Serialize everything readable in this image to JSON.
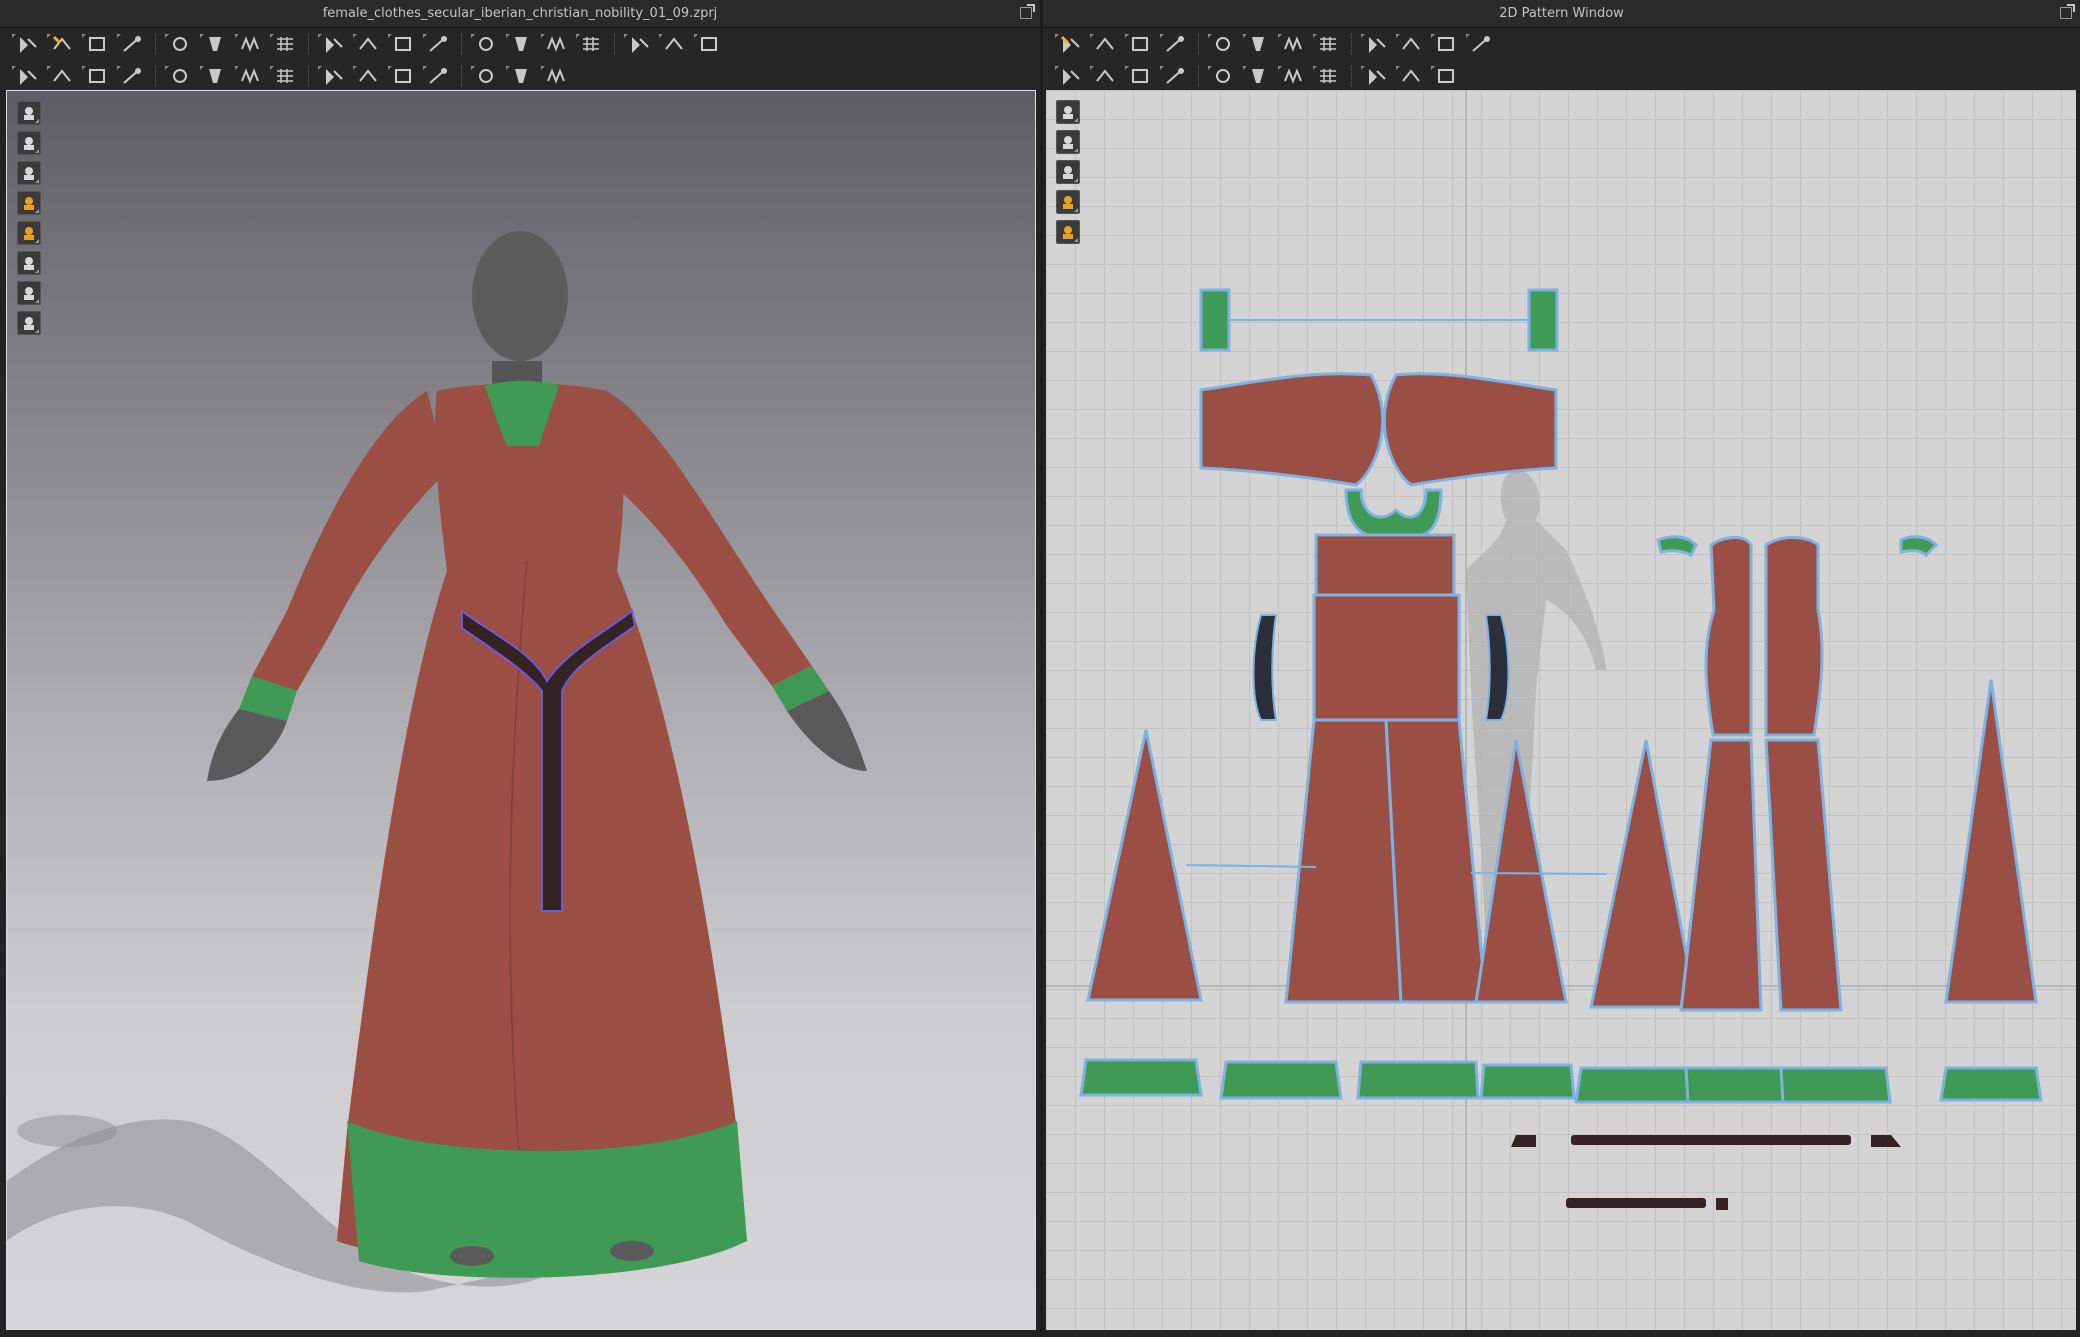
{
  "windows": {
    "left_title": "female_clothes_secular_iberian_christian_nobility_01_09.zprj",
    "right_title": "2D Pattern Window"
  },
  "colors": {
    "fabric_red": "#9a4e44",
    "fabric_green": "#3f9a55",
    "belt_dark": "#352222",
    "pattern_outline": "#7eb2e2",
    "avatar_gray": "#5a5a5a"
  },
  "toolbar_3d_row1": [
    "download-icon",
    "move-icon",
    "transform-icon",
    "fold-icon",
    "fold-arrow-icon",
    "fold-rotate-icon",
    "pin-icon",
    "tape-icon",
    "select-mesh-icon",
    "brush-icon",
    "outfit-icon",
    "garment-icon",
    "shirt-icon",
    "avatar-icon",
    "avatar-pose-icon",
    "measure-icon",
    "ruler-icon",
    "grid-icon",
    "grid-fine-icon"
  ],
  "toolbar_3d_row2": [
    "walk-icon",
    "pin-needle-icon",
    "pin-multi-icon",
    "scissors-icon",
    "cut-icon",
    "fold-up-icon",
    "zipper-icon",
    "trim-icon",
    "button-icon",
    "buttonhole-icon",
    "topstitch-icon",
    "measure-tape-icon",
    "plane-icon",
    "plane-flat-icon",
    "align-icon"
  ],
  "toolbar_2d_row1": [
    "select-pattern-icon",
    "edit-point-icon",
    "transform-pattern-icon",
    "polygon-icon",
    "rectangle-icon",
    "ellipse-icon",
    "internal-line-icon",
    "sewing-icon",
    "pleat-icon",
    "avatar-2d-icon",
    "grid-icon",
    "grid-fine-icon"
  ],
  "toolbar_2d_row2": [
    "segment-sew-icon",
    "free-sew-icon",
    "tack-icon",
    "fold-arrange-icon",
    "steam-icon",
    "garment-fit-icon",
    "trace-icon",
    "zipper-icon",
    "trim-icon",
    "line-icon",
    "dash-line-icon"
  ],
  "viewport3d_tools": [
    "render-mode-icon",
    "texture-mode-icon",
    "sewing-lines-icon",
    "avatar-display-icon",
    "fabric-display-icon",
    "shading-icon",
    "skin-display-icon",
    "avatar-texture-icon"
  ],
  "viewport2d_tools": [
    "brush-2d-icon",
    "garment-2d-icon",
    "info-icon",
    "fabric-2d-icon",
    "pattern-display-icon"
  ]
}
